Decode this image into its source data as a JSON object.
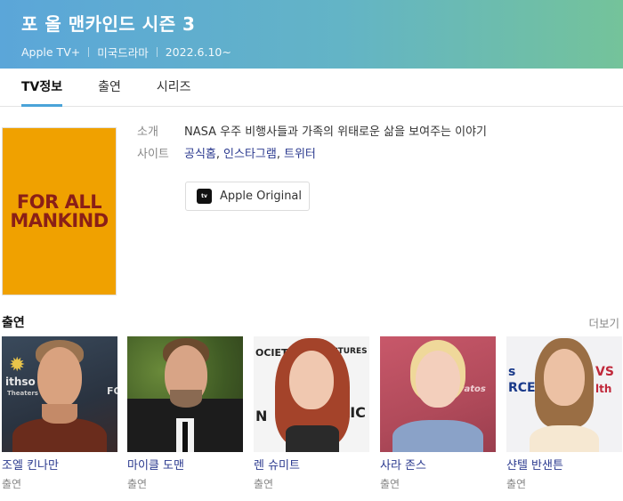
{
  "header": {
    "title": "포 올 맨카인드 시즌 3",
    "meta": [
      "Apple TV+",
      "미국드라마",
      "2022.6.10~"
    ]
  },
  "tabs": [
    {
      "label": "TV정보",
      "active": true
    },
    {
      "label": "출연",
      "active": false
    },
    {
      "label": "시리즈",
      "active": false
    }
  ],
  "poster": {
    "line1": "FOR ALL",
    "line2": "MANKIND"
  },
  "info": {
    "intro_label": "소개",
    "intro_value": "NASA 우주 비행사들과 가족의 위태로운 삶을 보여주는 이야기",
    "site_label": "사이트",
    "sites": [
      "공식홈",
      "인스타그램",
      "트위터"
    ],
    "separator": ","
  },
  "badge": {
    "icon_text": "tv",
    "label": "Apple Original"
  },
  "cast_section": {
    "title": "출연",
    "more": "더보기",
    "members": [
      {
        "name": "조엘 킨나만",
        "role": "출연"
      },
      {
        "name": "마이클 도맨",
        "role": "출연"
      },
      {
        "name": "렌 슈미트",
        "role": "출연"
      },
      {
        "name": "사라 존스",
        "role": "출연"
      },
      {
        "name": "샨텔 반샌튼",
        "role": "출연"
      }
    ]
  },
  "photo_text": {
    "p1_a": "ithso",
    "p1_b": "Theaters",
    "p1_c": "FO",
    "p3_a": "OCIET",
    "p3_b": "CTURES",
    "p3_c": "N",
    "p3_d": "LIC",
    "p4_a": "vatos",
    "p5_a": "s",
    "p5_b": "RCE",
    "p5_c": "VS",
    "p5_d": "lth"
  },
  "colors": {
    "header_start": "#5ba6d9",
    "header_end": "#74c39a",
    "tab_underline": "#4aa3d8",
    "link": "#2b3a8f",
    "poster_bg": "#f0a100",
    "poster_text": "#8a1f17"
  }
}
